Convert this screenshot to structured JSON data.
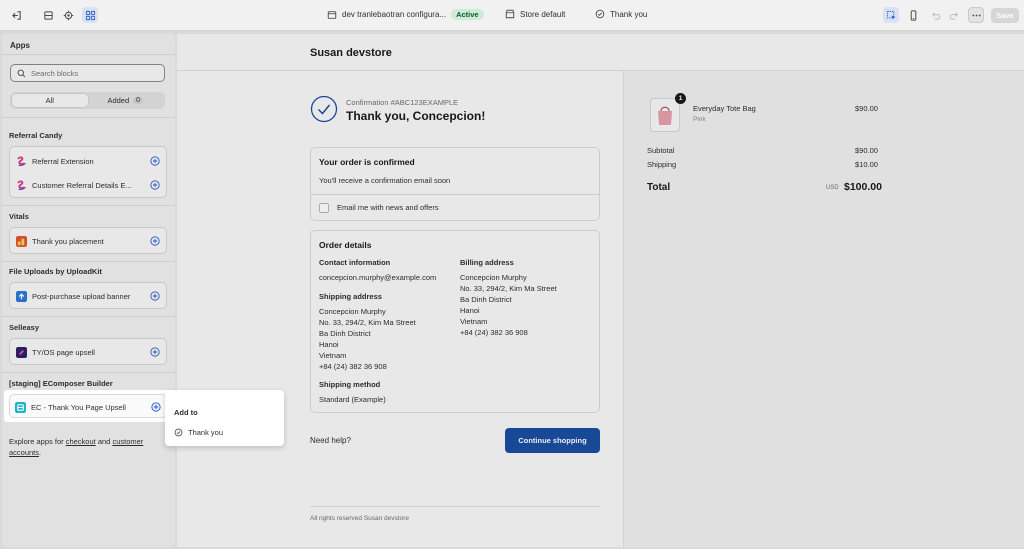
{
  "topbar": {
    "theme_name": "dev tranlebaotran configura...",
    "status_badge": "Active",
    "store_label": "Store default",
    "page_label": "Thank you",
    "save_label": "Save"
  },
  "left_panel": {
    "title": "Apps",
    "search": {
      "placeholder": "Search blocks",
      "value": ""
    },
    "segments": {
      "all_label": "All",
      "added_label": "Added",
      "added_count": "0"
    },
    "groups": [
      {
        "title": "Referral Candy",
        "items": [
          "Referral Extension",
          "Customer Referral Details E..."
        ]
      },
      {
        "title": "Vitals",
        "items": [
          "Thank you placement"
        ]
      },
      {
        "title": "File Uploads by UploadKit",
        "items": [
          "Post-purchase upload banner"
        ]
      },
      {
        "title": "Selleasy",
        "items": [
          "TY/OS page upsell"
        ]
      },
      {
        "title": "[staging] EComposer Builder",
        "items": [
          "EC - Thank You Page Upsell"
        ]
      }
    ],
    "explore": {
      "prefix": "Explore apps for",
      "checkout_link": "checkout",
      "and": "and",
      "accounts_link": "customer accounts",
      "suffix": "."
    }
  },
  "popover": {
    "title": "Add to",
    "item": "Thank you"
  },
  "preview": {
    "store_name": "Susan devstore",
    "confirmation_number": "Confirmation #ABC123EXAMPLE",
    "thank_you_title": "Thank you, Concepcion!",
    "order_confirmed": {
      "title": "Your order is confirmed",
      "text": "You'll receive a confirmation email soon",
      "email_opt": "Email me with news and offers"
    },
    "order_details": {
      "title": "Order details",
      "contact_title": "Contact information",
      "contact_email": "concepcion.murphy@example.com",
      "shipping_title": "Shipping address",
      "shipping_lines": [
        "Concepcion Murphy",
        "No. 33, 294/2, Kim Ma Street",
        "Ba Dinh District",
        "Hanoi",
        "Vietnam",
        "+84 (24) 382 36 908"
      ],
      "billing_title": "Billing address",
      "billing_lines": [
        "Concepcion Murphy",
        "No. 33, 294/2, Kim Ma Street",
        "Ba Dinh District",
        "Hanoi",
        "Vietnam",
        "+84 (24) 382 36 908"
      ],
      "method_title": "Shipping method",
      "method_value": "Standard (Example)"
    },
    "need_help": "Need help?",
    "continue_label": "Continue shopping",
    "footer": "All rights reserved Susan devstore",
    "summary": {
      "quantity": "1",
      "product_name": "Everyday Tote Bag",
      "product_variant": "Pink",
      "product_price": "$90.00",
      "subtotal_label": "Subtotal",
      "subtotal_value": "$90.00",
      "shipping_label": "Shipping",
      "shipping_value": "$10.00",
      "total_label": "Total",
      "currency": "USD",
      "total_value": "$100.00"
    }
  },
  "colors": {
    "accent": "#1a4fa3",
    "active_badge": "#cdebd6",
    "referral_logo": "#d6418f",
    "vitals_logo": "#e4572e",
    "uploadkit_logo": "#2a7ad8",
    "selleasy_logo": "#2b2170",
    "ecomposer_logo": "#1fb5c9"
  }
}
